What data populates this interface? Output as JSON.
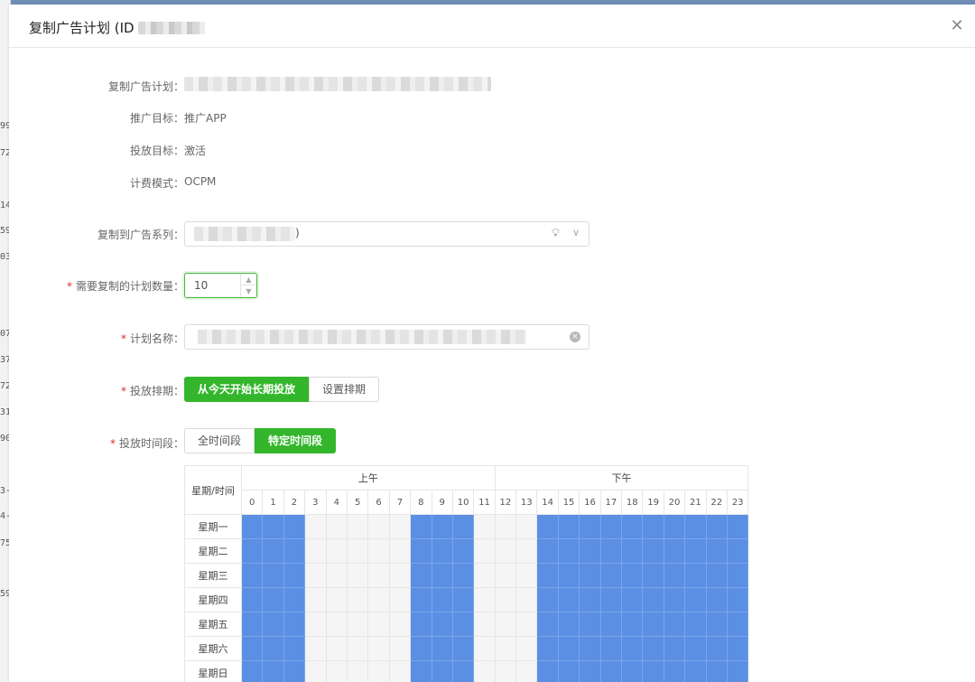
{
  "background": {
    "side_numbers": [
      "99",
      "72",
      "14",
      "59",
      "03",
      "07",
      "37",
      "72",
      "31",
      "90",
      "3-",
      "4-",
      "75",
      "59"
    ]
  },
  "modal": {
    "title": "复制广告计划 (ID",
    "close_icon": "close-icon"
  },
  "form": {
    "copy_plan_label": "复制广告计划：",
    "promo_goal_label": "推广目标：",
    "promo_goal_value": "推广APP",
    "delivery_goal_label": "投放目标：",
    "delivery_goal_value": "激活",
    "billing_label": "计费模式：",
    "billing_value": "OCPM",
    "target_series_label": "复制到广告系列：",
    "target_series_suffix": ")",
    "count_label": "需要复制的计划数量：",
    "count_value": "10",
    "plan_name_label": "计划名称：",
    "schedule_label": "投放排期：",
    "schedule_options": [
      "从今天开始长期投放",
      "设置排期"
    ],
    "schedule_selected": 0,
    "timeslot_label": "投放时间段：",
    "timeslot_options": [
      "全时间段",
      "特定时间段"
    ],
    "timeslot_selected": 1,
    "required_mark": "*"
  },
  "timetable": {
    "corner_label": "星期/时间",
    "am_label": "上午",
    "pm_label": "下午",
    "hours": [
      "0",
      "1",
      "2",
      "3",
      "4",
      "5",
      "6",
      "7",
      "8",
      "9",
      "10",
      "11",
      "12",
      "13",
      "14",
      "15",
      "16",
      "17",
      "18",
      "19",
      "20",
      "21",
      "22",
      "23"
    ],
    "days": [
      "星期一",
      "星期二",
      "星期三",
      "星期四",
      "星期五",
      "星期六",
      "星期日"
    ],
    "selected_hours": [
      0,
      1,
      2,
      8,
      9,
      10,
      14,
      15,
      16,
      17,
      18,
      19,
      20,
      21,
      22,
      23
    ],
    "selected_color": "#5a8fe3"
  },
  "colors": {
    "accent": "#33b62b",
    "required": "#e02b2b"
  }
}
